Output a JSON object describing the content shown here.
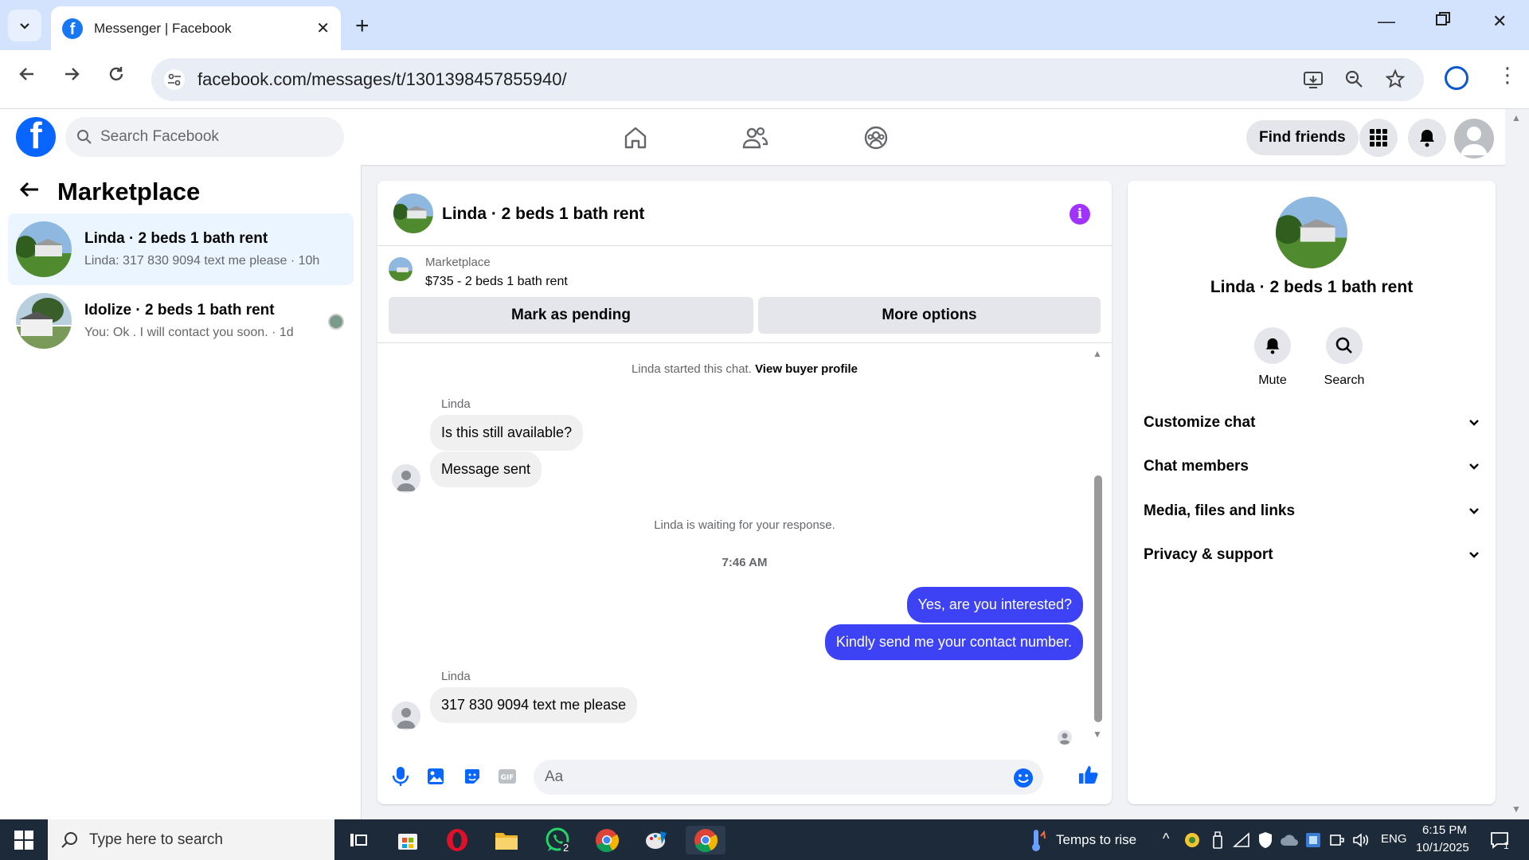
{
  "browser": {
    "tab_title": "Messenger | Facebook",
    "url": "facebook.com/messages/t/1301398457855940/"
  },
  "fb": {
    "search_placeholder": "Search Facebook",
    "find_friends": "Find friends"
  },
  "left": {
    "title": "Marketplace",
    "conversations": [
      {
        "name": "Linda · 2 beds 1 bath rent",
        "last": "Linda: 317 830 9094 text me please · 10h"
      },
      {
        "name": "Idolize · 2 beds 1 bath rent",
        "last": "You: Ok . I will contact you soon. · 1d"
      }
    ]
  },
  "chat": {
    "title": "Linda · 2 beds 1 bath rent",
    "marketplace_label": "Marketplace",
    "listing": "$735 - 2 beds 1 bath rent",
    "mark_pending": "Mark as pending",
    "more_options": "More options",
    "started_text": "Linda started this chat.",
    "view_buyer": "View buyer profile",
    "sender1": "Linda",
    "msg1": "Is this still available?",
    "msg2": "Message sent",
    "waiting": "Linda is waiting for your response.",
    "time": "7:46 AM",
    "out1": "Yes, are you interested?",
    "out2": "Kindly send me your contact number.",
    "sender2": "Linda",
    "msg3": "317 830 9094 text me please",
    "input_placeholder": "Aa"
  },
  "right": {
    "name": "Linda · 2 beds 1 bath rent",
    "mute": "Mute",
    "search": "Search",
    "rows": [
      "Customize chat",
      "Chat members",
      "Media, files and links",
      "Privacy & support"
    ]
  },
  "taskbar": {
    "search_placeholder": "Type here to search",
    "whatsapp_badge": "2",
    "weather": "Temps to rise",
    "lang": "ENG",
    "time": "6:15 PM",
    "date": "10/1/2025",
    "notif_count": "1"
  }
}
